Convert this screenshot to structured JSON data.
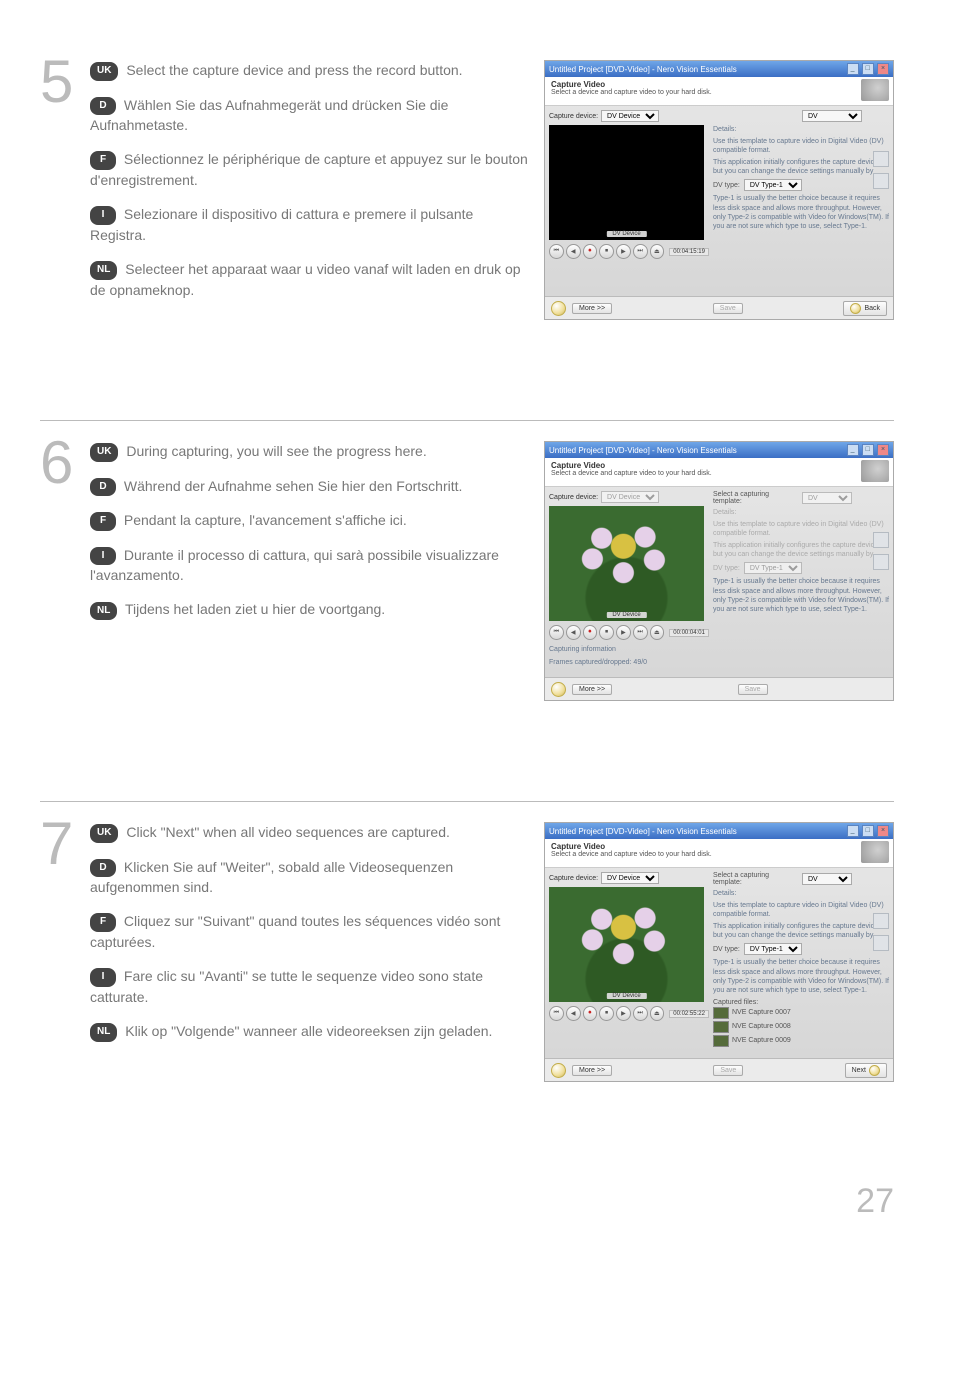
{
  "page_number": "27",
  "steps": [
    {
      "num": "5",
      "langs": [
        {
          "code": "UK",
          "text": "Select the capture device and press the record button."
        },
        {
          "code": "D",
          "text": "Wählen Sie das Aufnahmegerät und drücken Sie die Aufnahmetaste."
        },
        {
          "code": "F",
          "text": "Sélectionnez le périphérique de capture et appuyez sur le bouton d'enregistrement."
        },
        {
          "code": "I",
          "text": "Selezionare il dispositivo di cattura e premere il pulsante Registra."
        },
        {
          "code": "NL",
          "text": "Selecteer het apparaat waar u video vanaf wilt laden en druk op de opnameknop."
        }
      ]
    },
    {
      "num": "6",
      "langs": [
        {
          "code": "UK",
          "text": "During capturing, you will see the progress here."
        },
        {
          "code": "D",
          "text": "Während der Aufnahme sehen Sie hier den Fortschritt."
        },
        {
          "code": "F",
          "text": "Pendant la capture, l'avancement s'affiche ici."
        },
        {
          "code": "I",
          "text": "Durante il processo di cattura, qui sarà possibile visualizzare l'avanzamento."
        },
        {
          "code": "NL",
          "text": "Tijdens het laden ziet u hier de voortgang."
        }
      ]
    },
    {
      "num": "7",
      "langs": [
        {
          "code": "UK",
          "text": "Click \"Next\" when all video sequences are captured."
        },
        {
          "code": "D",
          "text": "Klicken Sie auf \"Weiter\", sobald alle Videosequenzen aufgenommen sind."
        },
        {
          "code": "F",
          "text": "Cliquez sur \"Suivant\" quand toutes les séquences vidéo sont capturées."
        },
        {
          "code": "I",
          "text": "Fare clic su \"Avanti\" se tutte le sequenze video sono state catturate."
        },
        {
          "code": "NL",
          "text": "Klik op \"Volgende\" wanneer alle videoreeksen zijn geladen."
        }
      ]
    }
  ],
  "screenshot_common": {
    "window_title": "Untitled Project [DVD-Video] - Nero Vision Essentials",
    "header_title": "Capture Video",
    "header_subtitle": "Select a device and capture video to your hard disk.",
    "capture_device_label": "Capture device:",
    "capture_device_value": "DV Device",
    "preview_label": "DV Device",
    "template_label": "Select a capturing template:",
    "template_value": "DV",
    "details_label": "Details:",
    "details_text1": "Use this template to capture video in Digital Video (DV) compatible format.",
    "details_text2": "This application initially configures the capture device, but you can change the device settings manually by",
    "dv_type_label": "DV type:",
    "dv_type_value": "DV Type-1",
    "dv_type_text": "Type-1 is usually the better choice because it requires less disk space and allows more throughput. However, only Type-2 is compatible with Video for Windows(TM). If you are not sure which type to use, select Type-1.",
    "btn_more": "More >>",
    "btn_save": "Save",
    "btn_back": "Back",
    "btn_next": "Next",
    "controls": [
      "⏮",
      "◀",
      "⏺",
      "⏹",
      "▶",
      "⏭",
      "⏏"
    ]
  },
  "screenshots": {
    "s5": {
      "timecode": "00:04:15:19",
      "preview_black": true,
      "footer_right": "back"
    },
    "s6": {
      "timecode": "00:00:04:01",
      "preview_black": false,
      "device_disabled": true,
      "template_disabled": true,
      "capturing_info_label": "Capturing information",
      "capturing_info_value": "Frames captured/dropped: 49/0",
      "footer_right": "none"
    },
    "s7": {
      "timecode": "00:02:55:22",
      "preview_black": false,
      "captured_label": "Captured files:",
      "captured_files": [
        "NVE Capture 0007",
        "NVE Capture 0008",
        "NVE Capture 0009"
      ],
      "footer_right": "next"
    }
  }
}
